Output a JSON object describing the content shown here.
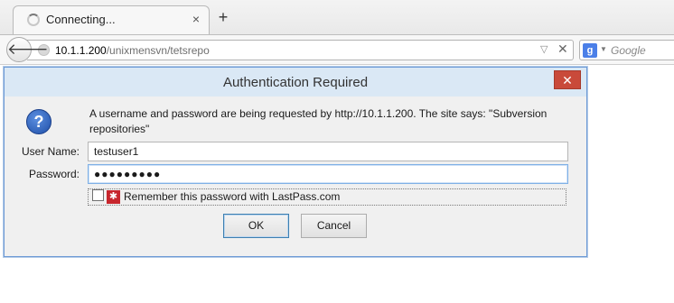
{
  "browser": {
    "tab": {
      "title": "Connecting..."
    },
    "new_tab_label": "+",
    "tab_close_label": "×",
    "url": {
      "host": "10.1.1.200",
      "path": "/unixmensvn/tetsrepo"
    },
    "search": {
      "engine_icon": "g-icon",
      "engine_glyph": "g",
      "placeholder": "Google"
    },
    "back_glyph": "🡐",
    "stop_glyph": "✕",
    "dropmarker_glyph": "▽"
  },
  "dialog": {
    "title": "Authentication Required",
    "close_glyph": "✕",
    "question_glyph": "?",
    "message": "A username and password are being requested by http://10.1.1.200. The site says: \"Subversion repositories\"",
    "username_label": "User Name:",
    "username_value": "testuser1",
    "password_label": "Password:",
    "password_value": "●●●●●●●●●",
    "remember": {
      "checked": false,
      "icon": "lastpass-icon",
      "icon_glyph": "✱",
      "label": "Remember this password with LastPass.com"
    },
    "ok_label": "OK",
    "cancel_label": "Cancel"
  },
  "colors": {
    "dialog_titlebar": "#dae8f5",
    "dialog_border": "#6d9ad6",
    "close_button": "#c94a3a",
    "lastpass_red": "#c7262d"
  }
}
